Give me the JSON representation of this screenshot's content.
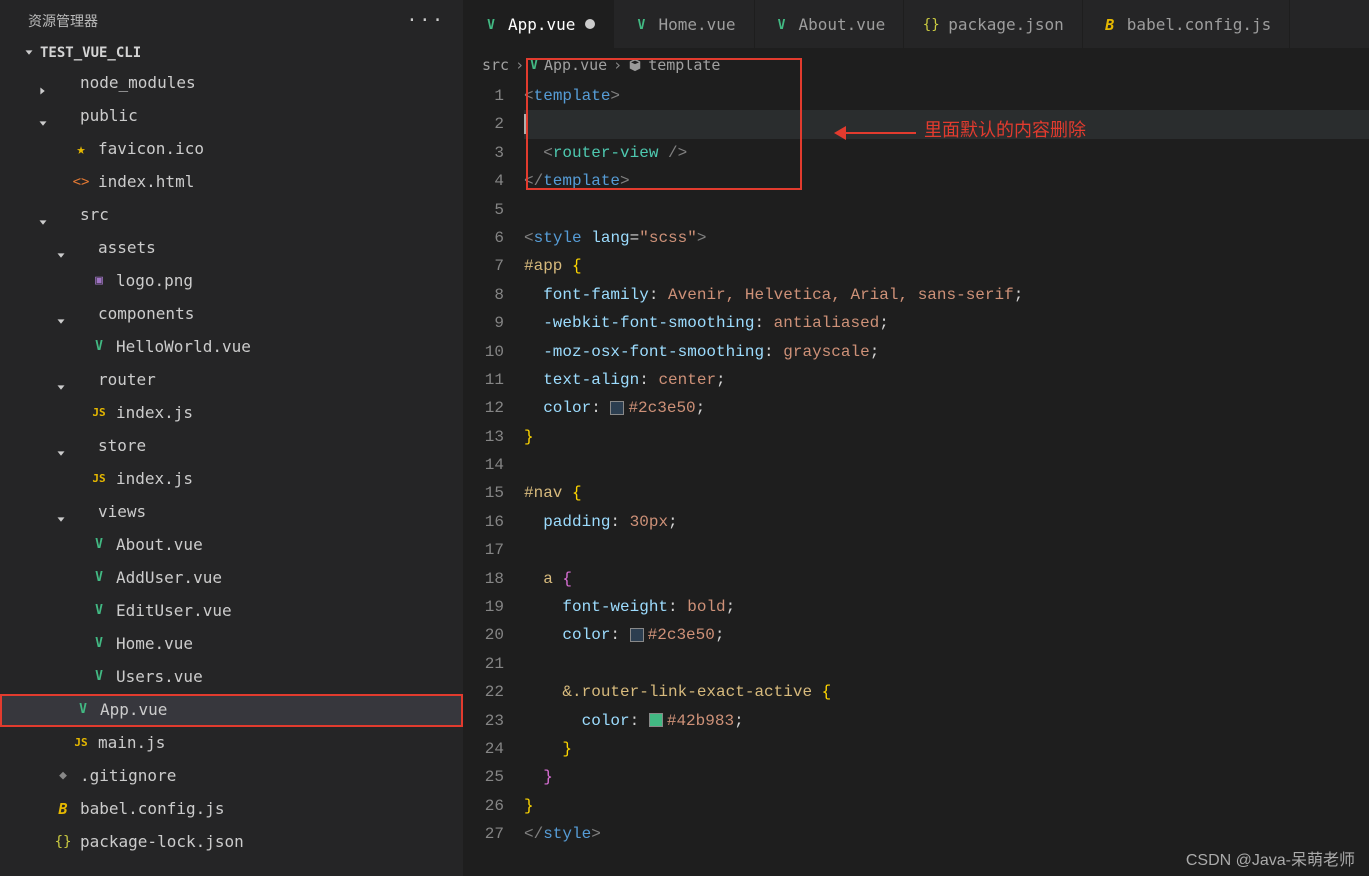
{
  "sidebar": {
    "title": "资源管理器",
    "project": "TEST_VUE_CLI",
    "tree": [
      {
        "depth": 0,
        "chev": "right",
        "icon": "",
        "label": "node_modules"
      },
      {
        "depth": 0,
        "chev": "down",
        "icon": "",
        "label": "public"
      },
      {
        "depth": 1,
        "chev": "",
        "icon": "star",
        "label": "favicon.ico"
      },
      {
        "depth": 1,
        "chev": "",
        "icon": "html",
        "label": "index.html"
      },
      {
        "depth": 0,
        "chev": "down",
        "icon": "",
        "label": "src"
      },
      {
        "depth": 1,
        "chev": "down",
        "icon": "",
        "label": "assets"
      },
      {
        "depth": 2,
        "chev": "",
        "icon": "img",
        "label": "logo.png"
      },
      {
        "depth": 1,
        "chev": "down",
        "icon": "",
        "label": "components"
      },
      {
        "depth": 2,
        "chev": "",
        "icon": "vue",
        "label": "HelloWorld.vue"
      },
      {
        "depth": 1,
        "chev": "down",
        "icon": "",
        "label": "router"
      },
      {
        "depth": 2,
        "chev": "",
        "icon": "js",
        "label": "index.js"
      },
      {
        "depth": 1,
        "chev": "down",
        "icon": "",
        "label": "store"
      },
      {
        "depth": 2,
        "chev": "",
        "icon": "js",
        "label": "index.js"
      },
      {
        "depth": 1,
        "chev": "down",
        "icon": "",
        "label": "views"
      },
      {
        "depth": 2,
        "chev": "",
        "icon": "vue",
        "label": "About.vue"
      },
      {
        "depth": 2,
        "chev": "",
        "icon": "vue",
        "label": "AddUser.vue"
      },
      {
        "depth": 2,
        "chev": "",
        "icon": "vue",
        "label": "EditUser.vue"
      },
      {
        "depth": 2,
        "chev": "",
        "icon": "vue",
        "label": "Home.vue"
      },
      {
        "depth": 2,
        "chev": "",
        "icon": "vue",
        "label": "Users.vue"
      },
      {
        "depth": 1,
        "chev": "",
        "icon": "vue",
        "label": "App.vue",
        "active": true,
        "hl": true
      },
      {
        "depth": 1,
        "chev": "",
        "icon": "js",
        "label": "main.js"
      },
      {
        "depth": 0,
        "chev": "",
        "icon": "git",
        "label": ".gitignore"
      },
      {
        "depth": 0,
        "chev": "",
        "icon": "babel",
        "label": "babel.config.js"
      },
      {
        "depth": 0,
        "chev": "",
        "icon": "json",
        "label": "package-lock.json"
      }
    ]
  },
  "tabs": [
    {
      "icon": "vue",
      "label": "App.vue",
      "active": true,
      "modified": true
    },
    {
      "icon": "vue",
      "label": "Home.vue"
    },
    {
      "icon": "vue",
      "label": "About.vue"
    },
    {
      "icon": "json",
      "label": "package.json"
    },
    {
      "icon": "babel",
      "label": "babel.config.js"
    }
  ],
  "breadcrumbs": {
    "a": "src",
    "b": "App.vue",
    "c": "template"
  },
  "annotation": "里面默认的内容删除",
  "code": {
    "colors": {
      "c1": "#2c3e50",
      "c2": "#2c3e50",
      "c3": "#42b983"
    },
    "tokens": {
      "template": "template",
      "routerview": "router-view",
      "style": "style",
      "lang": "lang",
      "scss": "\"scss\"",
      "app": "#app",
      "nav": "#nav",
      "a": "a",
      "ff": "font-family",
      "ffv": "Avenir, Helvetica, Arial, sans-serif",
      "wfs": "-webkit-font-smoothing",
      "wfsv": "antialiased",
      "mfs": "-moz-osx-font-smoothing",
      "mfsv": "grayscale",
      "ta": "text-align",
      "tav": "center",
      "col": "color",
      "pad": "padding",
      "padv": "30px",
      "fw": "font-weight",
      "fwv": "bold",
      "rla": "&.router-link-exact-active"
    }
  },
  "watermark": "CSDN @Java-呆萌老师"
}
